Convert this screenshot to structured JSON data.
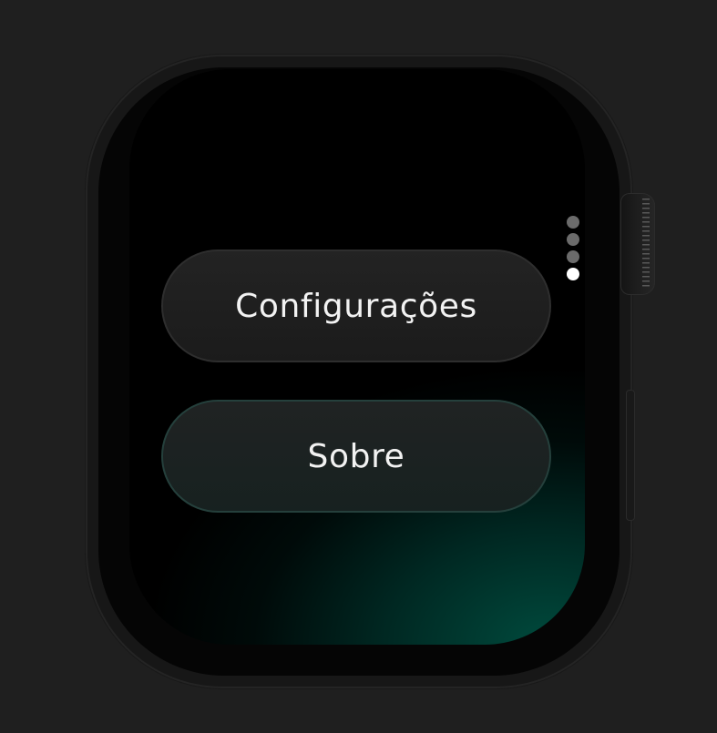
{
  "app": {
    "menu": [
      {
        "id": "configuracoes",
        "label": "Configurações"
      },
      {
        "id": "sobre",
        "label": "Sobre"
      }
    ]
  },
  "pagination": {
    "total_pages": 4,
    "current_page": 4
  },
  "colors": {
    "background": "#1f1f1f",
    "screen": "#000000",
    "accent_glow": "#004e40",
    "button_text": "#f2f2f2",
    "dot_inactive": "#6b6b6b",
    "dot_active": "#ffffff"
  }
}
